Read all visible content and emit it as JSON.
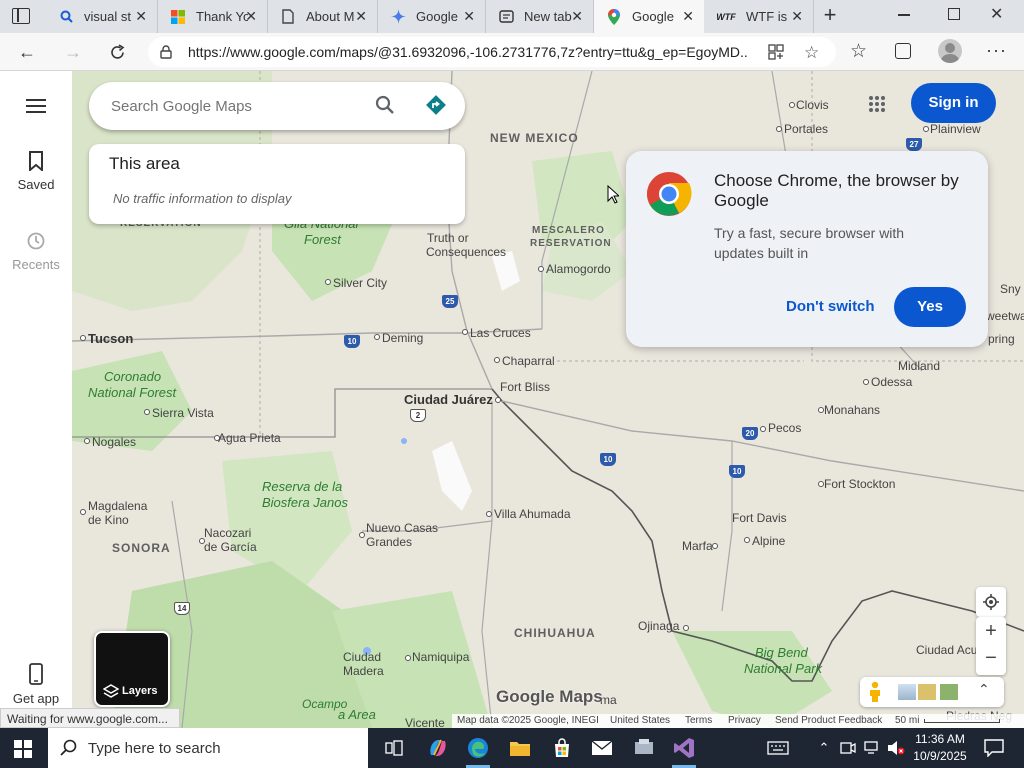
{
  "tabs": [
    {
      "label": "visual st",
      "icon": "search-icon"
    },
    {
      "label": "Thank Yo",
      "icon": "windows-logo-icon"
    },
    {
      "label": "About M",
      "icon": "page-icon"
    },
    {
      "label": "Google",
      "icon": "gemini-icon"
    },
    {
      "label": "New tab",
      "icon": "newtab-icon"
    },
    {
      "label": "Google",
      "icon": "maps-pin-icon"
    },
    {
      "label": "WTF is",
      "icon": "wtf-icon"
    }
  ],
  "address": {
    "url": "https://www.google.com/maps/@31.6932096,-106.2731776,7z?entry=ttu&g_ep=EgoyMD..."
  },
  "sidebar": {
    "saved": "Saved",
    "recents": "Recents",
    "get_app": "Get app"
  },
  "search": {
    "placeholder": "Search Google Maps"
  },
  "traffic": {
    "title": "This area",
    "message": "No traffic information to display"
  },
  "header": {
    "sign_in": "Sign in"
  },
  "chrome_prompt": {
    "title": "Choose Chrome, the browser by Google",
    "body": "Try a fast, secure browser with updates built in",
    "dont_switch": "Don't switch",
    "yes": "Yes"
  },
  "map_labels": {
    "new_mexico": "NEW MEXICO",
    "mescalero": "MESCALERO",
    "reservation2": "RESERVATION",
    "reservation": "RESERVATION",
    "gila": "Gila National",
    "forest": "Forest",
    "truth": "Truth or",
    "consequences": "Consequences",
    "alamogordo": "Alamogordo",
    "silver_city": "Silver City",
    "deming": "Deming",
    "las_cruces": "Las Cruces",
    "tucson": "Tucson",
    "coronado": "Coronado",
    "national_forest": "National Forest",
    "sierra_vista": "Sierra Vista",
    "nogales": "Nogales",
    "agua_prieta": "Agua Prieta",
    "chaparral": "Chaparral",
    "fort_bliss": "Fort Bliss",
    "ciudad_juarez": "Ciudad Juárez",
    "reserva": "Reserva de la",
    "biosfera": "Biosfera Janos",
    "magdalena": "Magdalena",
    "de_kino": "de Kino",
    "sonora": "SONORA",
    "nacozari": "Nacozari",
    "de_garcia": "de García",
    "nuevo_casas": "Nuevo Casas",
    "grandes": "Grandes",
    "villa_ahumada": "Villa Ahumada",
    "chihuahua": "CHIHUAHUA",
    "ojinaga": "Ojinaga",
    "ciudad_madera": "Ciudad",
    "madera": "Madera",
    "namiquipa": "Namiquipa",
    "clovis": "Clovis",
    "portales": "Portales",
    "plainview": "Plainview",
    "midland": "Midland",
    "odessa": "Odessa",
    "monahans": "Monahans",
    "pecos": "Pecos",
    "fort_stockton": "Fort Stockton",
    "fort_davis": "Fort Davis",
    "alpine": "Alpine",
    "marfa": "Marfa",
    "big_bend": "Big Bend",
    "national_park": "National Park",
    "ciudad_acuna": "Ciudad Acu",
    "snyder": "Sny",
    "sweetwater": "weetwa",
    "spring": "pring",
    "ocampo": "Ocampo",
    "vicente": "Vicente",
    "area": "a Area",
    "ma": "ma",
    "piedras": "Piedras Neg"
  },
  "shields": [
    "27",
    "25",
    "10",
    "2",
    "10",
    "20",
    "10",
    "14"
  ],
  "footer": {
    "map_data": "Map data ©2025 Google, INEGI",
    "united_states": "United States",
    "terms": "Terms",
    "privacy": "Privacy",
    "feedback": "Send Product Feedback",
    "scale": "50 mi"
  },
  "brand": "Google Maps",
  "layers": "Layers",
  "status": "Waiting for www.google.com...",
  "taskbar": {
    "search_placeholder": "Type here to search",
    "time": "11:36 AM",
    "date": "10/9/2025"
  },
  "colors": {
    "accent": "#0b57d0",
    "map_bg": "#e9e6dc",
    "green": "#c7e2b4",
    "taskbar": "#1f2633"
  }
}
